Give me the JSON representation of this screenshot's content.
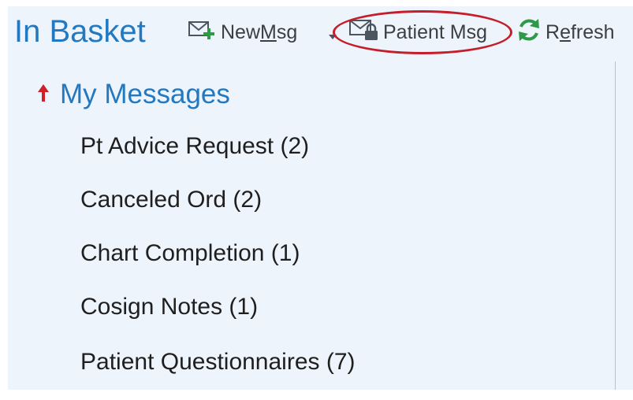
{
  "header": {
    "title": "In Basket"
  },
  "toolbar": {
    "new_msg": {
      "label_prefix": "New ",
      "label_underlined": "M",
      "label_suffix": "sg",
      "icon": "envelope-plus-icon",
      "has_dropdown": true
    },
    "patient_msg": {
      "label": "Patient Msg",
      "icon": "envelope-lock-icon"
    },
    "refresh": {
      "label_prefix": "R",
      "label_underlined": "e",
      "label_suffix": "fresh",
      "icon": "refresh-icon"
    }
  },
  "folder": {
    "title": "My Messages",
    "icon": "up-arrow-icon"
  },
  "messages": [
    {
      "label": "Pt Advice Request (2)"
    },
    {
      "label": "Canceled Ord (2)"
    },
    {
      "label": "Chart Completion (1)"
    },
    {
      "label": "Cosign Notes (1)"
    },
    {
      "label": "Patient Questionnaires (7)"
    }
  ],
  "colors": {
    "accent_blue": "#2379c0",
    "highlight_red": "#c41e2b",
    "refresh_green": "#2e9a48",
    "arrow_red": "#d11f2a",
    "panel_bg": "#eef4fb"
  }
}
